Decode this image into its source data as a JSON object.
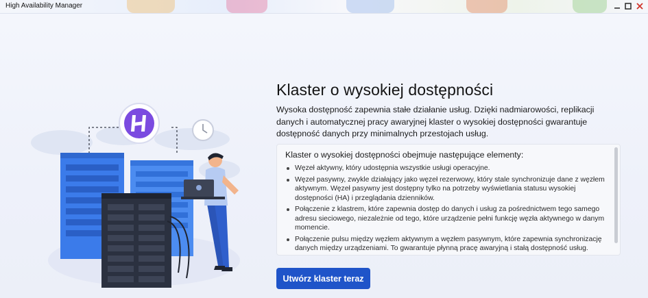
{
  "window": {
    "title": "High Availability Manager",
    "controls": [
      "minimize-icon",
      "maximize-icon",
      "close-icon"
    ]
  },
  "content": {
    "heading": "Klaster o wysokiej dostępności",
    "intro": "Wysoka dostępność zapewnia stałe działanie usług. Dzięki nadmiarowości, replikacji danych i automatycznej pracy awaryjnej klaster o wysokiej dostępności gwarantuje dostępność danych przy minimalnych przestojach usług.",
    "box": {
      "heading": "Klaster o wysokiej dostępności obejmuje następujące elementy:",
      "items": [
        "Węzeł aktywny, który udostępnia wszystkie usługi operacyjne.",
        "Węzeł pasywny, zwykle działający jako węzeł rezerwowy, który stale synchronizuje dane z węzłem aktywnym. Węzeł pasywny jest dostępny tylko na potrzeby wyświetlania statusu wysokiej dostępności (HA) i przeglądania dzienników.",
        "Połączenie z klastrem, które zapewnia dostęp do danych i usług za pośrednictwem tego samego adresu sieciowego, niezależnie od tego, które urządzenie pełni funkcję węzła aktywnego w danym momencie.",
        "Połączenie pulsu między węzłem aktywnym a węzłem pasywnym, które zapewnia synchronizację danych między urządzeniami. To gwarantuje płynną pracę awaryjną i stałą dostępność usług."
      ]
    },
    "cta_label": "Utwórz klaster teraz"
  },
  "colors": {
    "accent": "#1f54c9",
    "server_blue": "#3b7bea",
    "server_dark": "#2b3140",
    "logo_purple": "#7b4be0"
  },
  "illustration": {
    "icons": [
      "ha-logo-icon",
      "clock-icon",
      "server-rack-icon",
      "person-with-laptop-icon",
      "world-map-icon"
    ]
  }
}
